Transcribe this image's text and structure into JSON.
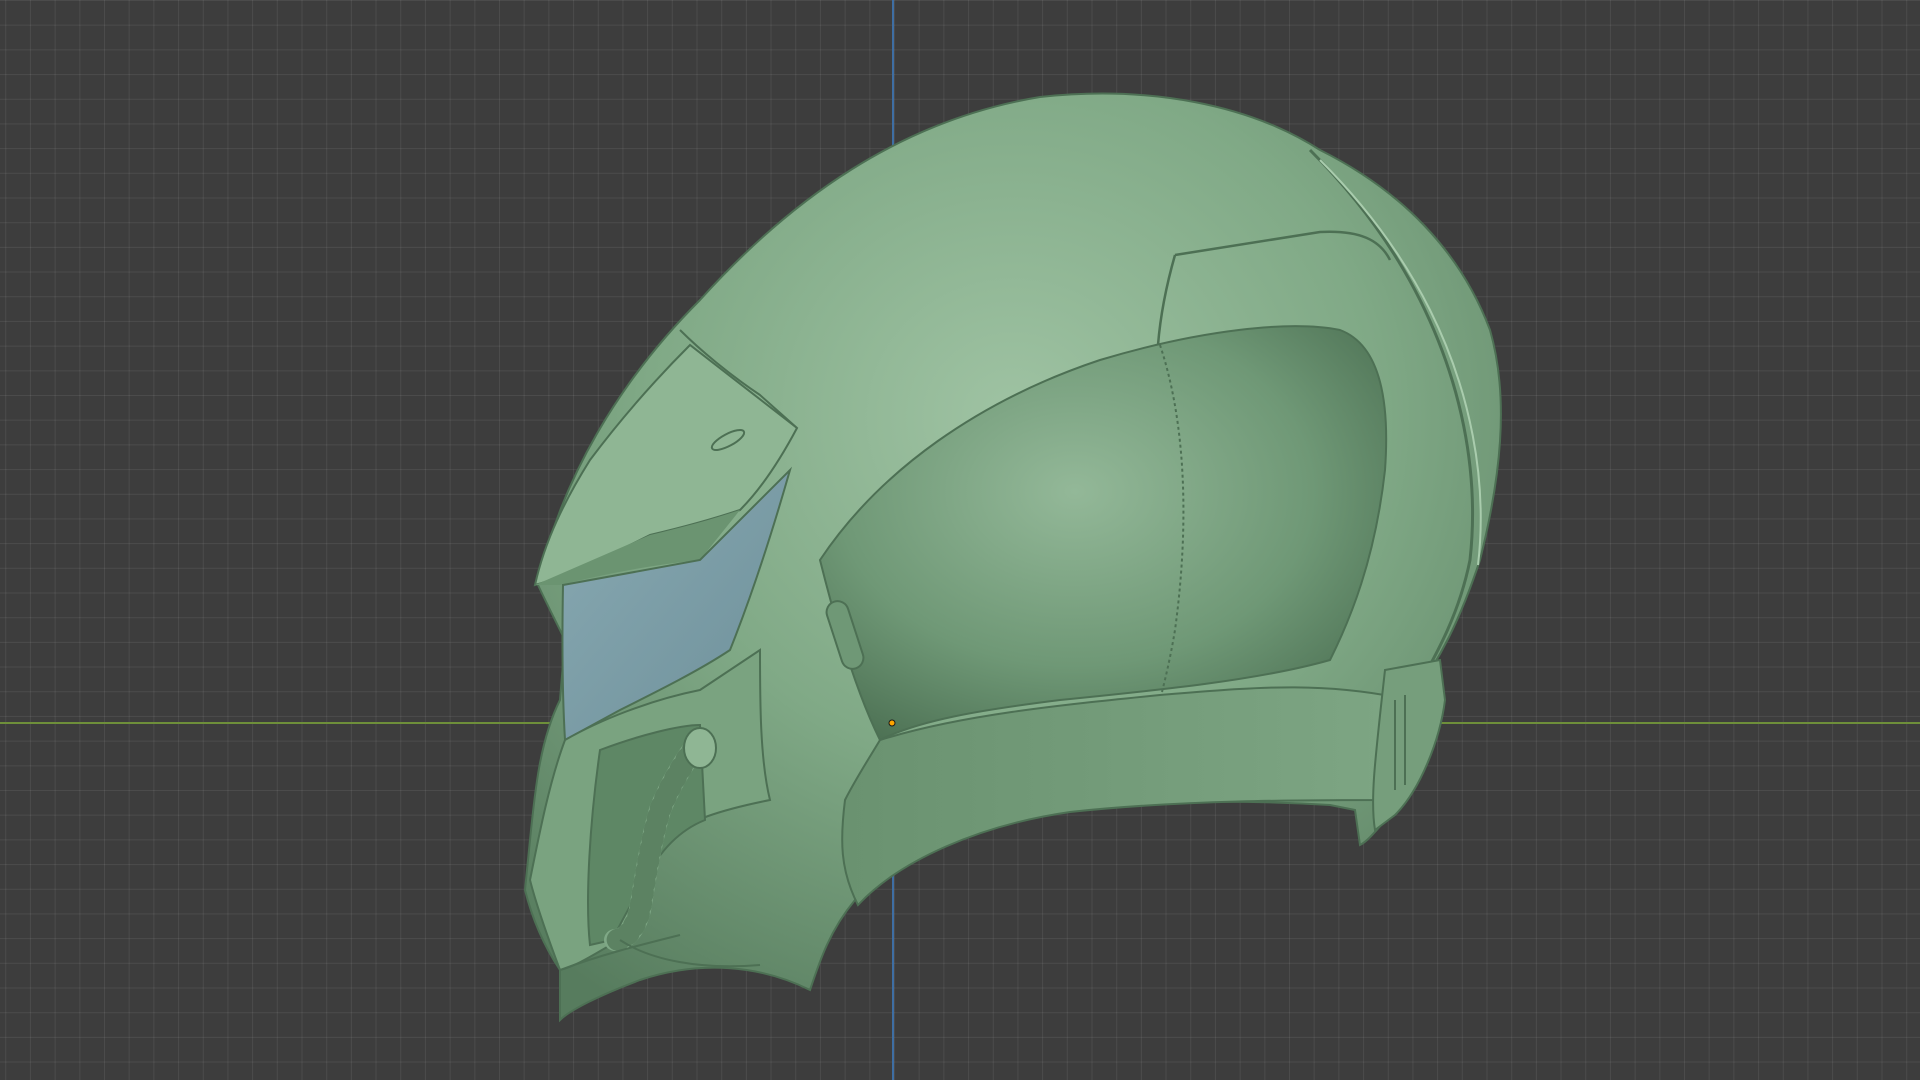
{
  "viewport": {
    "view": "3D viewport",
    "grid": true,
    "background_color": "#3d3d3d",
    "grid_line_color": "#4a4a4a",
    "axis_x_color": "#6e8f3a",
    "axis_y_color": "#3e6ea3"
  },
  "model": {
    "object": "helmet-mesh",
    "material_color": "#7fa886",
    "visor_color": "#7f9ea8",
    "origin_marker_color": "#ffa500"
  }
}
